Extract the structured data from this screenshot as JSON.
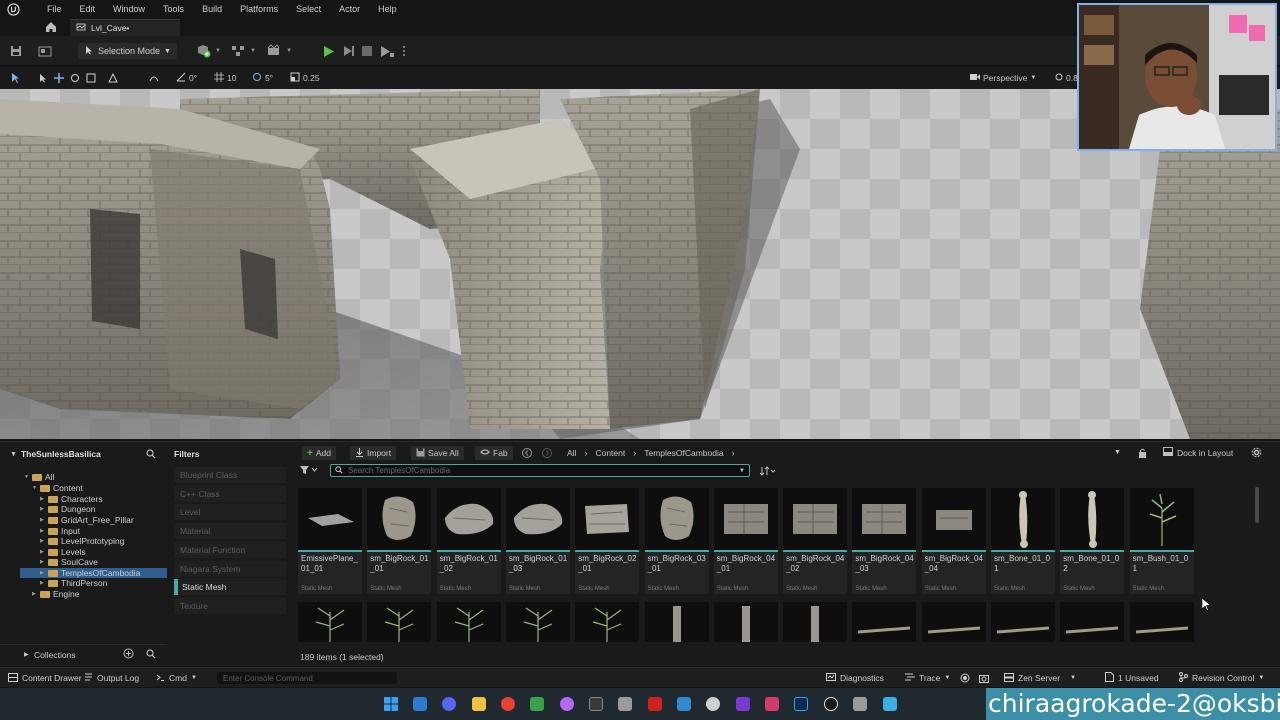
{
  "menu": {
    "items": [
      "File",
      "Edit",
      "Window",
      "Tools",
      "Build",
      "Platforms",
      "Select",
      "Actor",
      "Help"
    ]
  },
  "tab": {
    "title": "Lvl_Cave•"
  },
  "toolbar": {
    "mode_label": "Selection Mode"
  },
  "viewport_toolbar": {
    "angle_snap": "0°",
    "grid_snap": "10",
    "rotate_snap": "5°",
    "scale_snap": "0.25",
    "view_mode": "Perspective",
    "partial_value": "0.87"
  },
  "content_browser": {
    "project_name": "TheSunlessBasilica",
    "tree": [
      {
        "label": "All",
        "level": 0
      },
      {
        "label": "Content",
        "level": 1
      },
      {
        "label": "Characters",
        "level": 2
      },
      {
        "label": "Dungeon",
        "level": 2
      },
      {
        "label": "GridArt_Free_Pillar",
        "level": 2
      },
      {
        "label": "Input",
        "level": 2
      },
      {
        "label": "LevelPrototyping",
        "level": 2
      },
      {
        "label": "Levels",
        "level": 2
      },
      {
        "label": "SoulCave",
        "level": 2
      },
      {
        "label": "TemplesOfCambodia",
        "level": 2,
        "selected": true
      },
      {
        "label": "ThirdPerson",
        "level": 2
      },
      {
        "label": "Engine",
        "level": 1
      }
    ],
    "filters_label": "Filters",
    "filters": [
      {
        "label": "Blueprint Class",
        "active": false
      },
      {
        "label": "C++ Class",
        "active": false
      },
      {
        "label": "Level",
        "active": false
      },
      {
        "label": "Material",
        "active": false
      },
      {
        "label": "Material Function",
        "active": false
      },
      {
        "label": "Niagara System",
        "active": false
      },
      {
        "label": "Static Mesh",
        "active": true
      },
      {
        "label": "Texture",
        "active": false
      }
    ],
    "add_label": "Add",
    "import_label": "Import",
    "save_all_label": "Save All",
    "fab_label": "Fab",
    "breadcrumb": [
      "All",
      "Content",
      "TemplesOfCambodia"
    ],
    "dock_label": "Dock in Layout",
    "search_placeholder": "Search TemplesOfCambodia",
    "assets": [
      {
        "name": "EmissivePlane_01_01",
        "type": "Static Mesh",
        "shape": "plane"
      },
      {
        "name": "sm_BigRock_01_01",
        "type": "Static Mesh",
        "shape": "rock"
      },
      {
        "name": "sm_BigRock_01_02",
        "type": "Static Mesh",
        "shape": "rock-flat"
      },
      {
        "name": "sm_BigRock_01_03",
        "type": "Static Mesh",
        "shape": "rock-flat"
      },
      {
        "name": "sm_BigRock_02_01",
        "type": "Static Mesh",
        "shape": "rock-block"
      },
      {
        "name": "sm_BigRock_03_01",
        "type": "Static Mesh",
        "shape": "rock"
      },
      {
        "name": "sm_BigRock_04_01",
        "type": "Static Mesh",
        "shape": "slab"
      },
      {
        "name": "sm_BigRock_04_02",
        "type": "Static Mesh",
        "shape": "slab"
      },
      {
        "name": "sm_BigRock_04_03",
        "type": "Static Mesh",
        "shape": "slab"
      },
      {
        "name": "sm_BigRock_04_04",
        "type": "Static Mesh",
        "shape": "slab-small"
      },
      {
        "name": "sm_Bone_01_01",
        "type": "Static Mesh",
        "shape": "bone"
      },
      {
        "name": "sm_Bone_01_02",
        "type": "Static Mesh",
        "shape": "bone"
      },
      {
        "name": "sm_Bush_01_01",
        "type": "Static Mesh",
        "shape": "bush"
      }
    ],
    "item_count": "189 items (1 selected)",
    "collections_label": "Collections"
  },
  "statusbar": {
    "content_drawer": "Content Drawer",
    "output_log": "Output Log",
    "cmd": "Cmd",
    "console_placeholder": "Enter Console Command",
    "diagnostics": "Diagnostics",
    "trace": "Trace",
    "zen_server": "Zen Server",
    "unsaved": "1 Unsaved",
    "revision_control": "Revision Control"
  },
  "overlay": {
    "text": "chiraagrokade-2@oksbi"
  },
  "colors": {
    "accent": "#49a9a9",
    "selected_folder": "#2f5f8f",
    "play_green": "#58c24a",
    "overlay_bg": "#3d8fa8"
  }
}
